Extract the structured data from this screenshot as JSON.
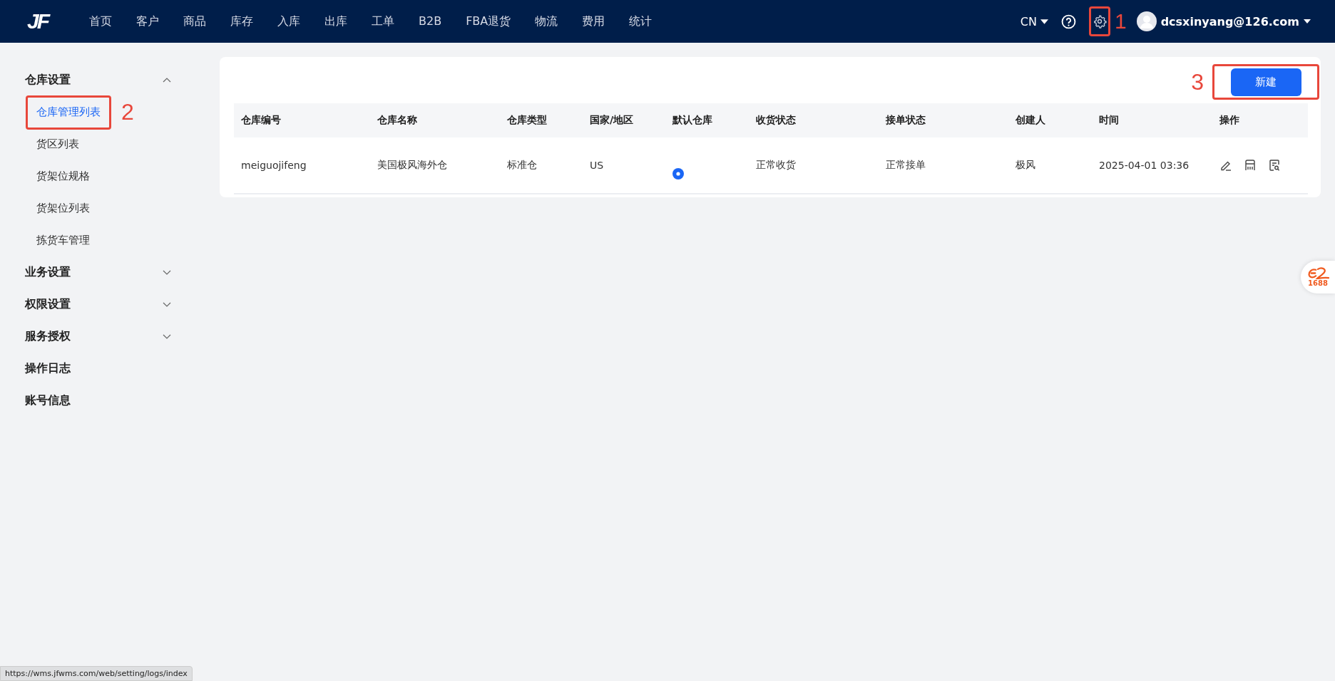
{
  "header": {
    "logo": "JF",
    "nav": [
      {
        "label": "首页"
      },
      {
        "label": "客户"
      },
      {
        "label": "商品"
      },
      {
        "label": "库存"
      },
      {
        "label": "入库"
      },
      {
        "label": "出库"
      },
      {
        "label": "工单"
      },
      {
        "label": "B2B"
      },
      {
        "label": "FBA退货"
      },
      {
        "label": "物流"
      },
      {
        "label": "费用"
      },
      {
        "label": "统计"
      }
    ],
    "language": "CN",
    "settings_annotation": "1",
    "user": "dcsxinyang@126.com"
  },
  "sidebar": [
    {
      "label": "仓库设置",
      "kind": "group",
      "expanded": true,
      "children": [
        {
          "label": "仓库管理列表",
          "selected": true,
          "annotation": "2"
        },
        {
          "label": "货区列表",
          "selected": false
        },
        {
          "label": "货架位规格",
          "selected": false
        },
        {
          "label": "货架位列表",
          "selected": false
        },
        {
          "label": "拣货车管理",
          "selected": false
        }
      ]
    },
    {
      "label": "业务设置",
      "kind": "group",
      "expanded": false
    },
    {
      "label": "权限设置",
      "kind": "group",
      "expanded": false
    },
    {
      "label": "服务授权",
      "kind": "group",
      "expanded": false
    },
    {
      "label": "操作日志",
      "kind": "link"
    },
    {
      "label": "账号信息",
      "kind": "link"
    }
  ],
  "toolbar": {
    "new_button": "新建",
    "annotation": "3"
  },
  "table": {
    "columns": [
      "仓库编号",
      "仓库名称",
      "仓库类型",
      "国家/地区",
      "默认仓库",
      "收货状态",
      "接单状态",
      "创建人",
      "时间",
      "操作"
    ],
    "rows": [
      {
        "code": "meiguojifeng",
        "name": "美国极风海外仓",
        "type": "标准仓",
        "country": "US",
        "is_default": true,
        "receiving": "正常收货",
        "ordering": "正常接单",
        "creator": "极风",
        "time": "2025-04-01 03:36"
      }
    ]
  },
  "side_badge": "1688",
  "status_url": "https://wms.jfwms.com/web/setting/logs/index"
}
